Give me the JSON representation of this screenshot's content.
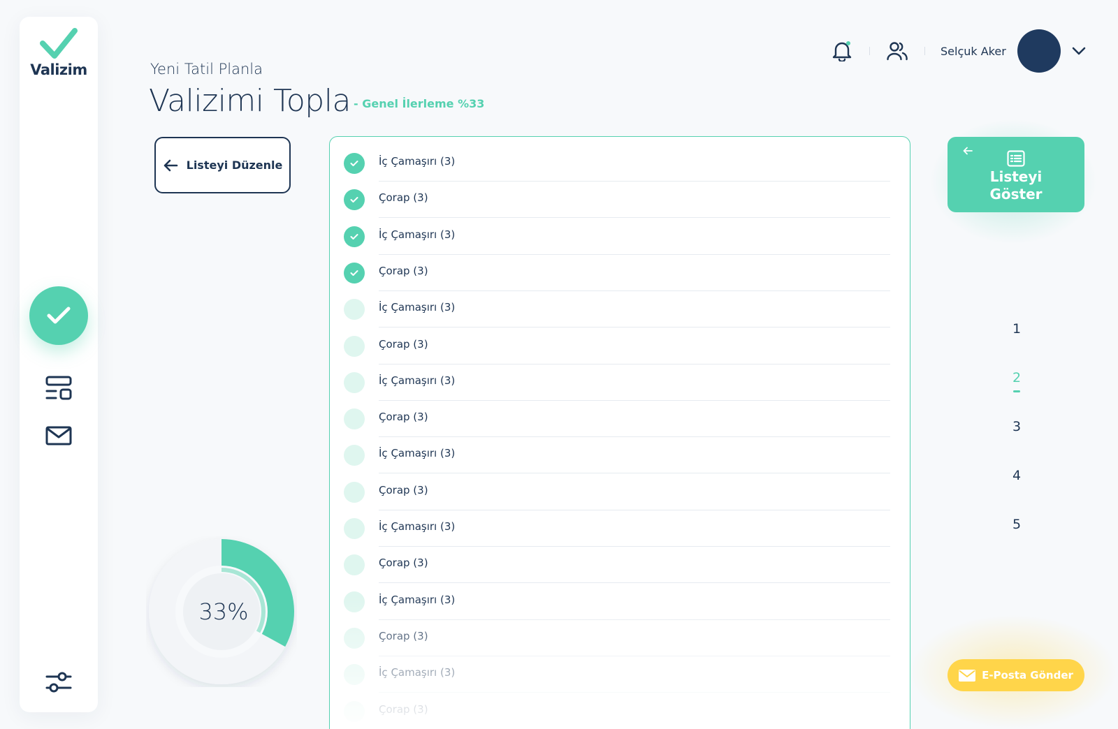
{
  "brand": {
    "name": "Valizim",
    "accent": "#55d1b0",
    "navy": "#1e3553",
    "yellow": "#ffd54a"
  },
  "sidebar": {
    "items": [
      {
        "icon": "check-icon",
        "active": true
      },
      {
        "icon": "layout-icon",
        "active": false
      },
      {
        "icon": "mail-icon",
        "active": false
      },
      {
        "icon": "sliders-icon",
        "active": false
      }
    ]
  },
  "header": {
    "subtitle": "Yeni Tatil Planla",
    "title": "Valizimi Topla",
    "progress_text": "- Genel İlerleme %33"
  },
  "user": {
    "name": "Selçuk Aker"
  },
  "edit_button": {
    "label": "Listeyi Düzenle"
  },
  "progress": {
    "percent": 33,
    "label": "33%"
  },
  "checklist": [
    {
      "label": "İç Çamaşırı (3)",
      "checked": true
    },
    {
      "label": "Çorap (3)",
      "checked": true
    },
    {
      "label": "İç Çamaşırı (3)",
      "checked": true
    },
    {
      "label": "Çorap (3)",
      "checked": true
    },
    {
      "label": "İç Çamaşırı (3)",
      "checked": false
    },
    {
      "label": "Çorap (3)",
      "checked": false
    },
    {
      "label": "İç Çamaşırı (3)",
      "checked": false
    },
    {
      "label": "Çorap (3)",
      "checked": false
    },
    {
      "label": "İç Çamaşırı (3)",
      "checked": false
    },
    {
      "label": "Çorap (3)",
      "checked": false
    },
    {
      "label": "İç Çamaşırı (3)",
      "checked": false
    },
    {
      "label": "Çorap (3)",
      "checked": false
    },
    {
      "label": "İç Çamaşırı (3)",
      "checked": false
    },
    {
      "label": "Çorap (3)",
      "checked": false
    },
    {
      "label": "İç Çamaşırı (3)",
      "checked": false
    },
    {
      "label": "Çorap (3)",
      "checked": false
    }
  ],
  "show_list_button": {
    "label_line1": "Listeyi",
    "label_line2": "Göster"
  },
  "pager": {
    "pages": [
      "1",
      "2",
      "3",
      "4",
      "5"
    ],
    "active": "2"
  },
  "email_button": {
    "label": "E-Posta Gönder"
  }
}
